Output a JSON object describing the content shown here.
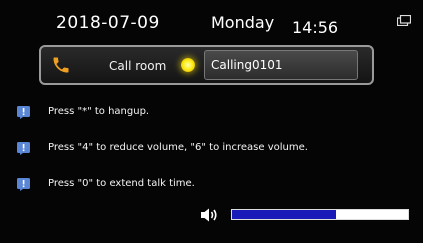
{
  "header": {
    "date": "2018-07-09",
    "weekday": "Monday",
    "time": "14:56"
  },
  "call_bar": {
    "label": "Call room",
    "room_name": "Calling0101",
    "status_color": "#ffef1a",
    "phone_icon_color": "#f0a020"
  },
  "hints": [
    "Press \"*\" to hangup.",
    "Press \"4\" to reduce volume, \"6\" to increase volume.",
    "Press \"0\" to extend talk time."
  ],
  "volume": {
    "level_percent": 59,
    "fill_color": "#1a1ab8"
  },
  "icons": [
    "window-icon",
    "phone-icon",
    "status-dot",
    "info-icon",
    "speaker-icon"
  ]
}
